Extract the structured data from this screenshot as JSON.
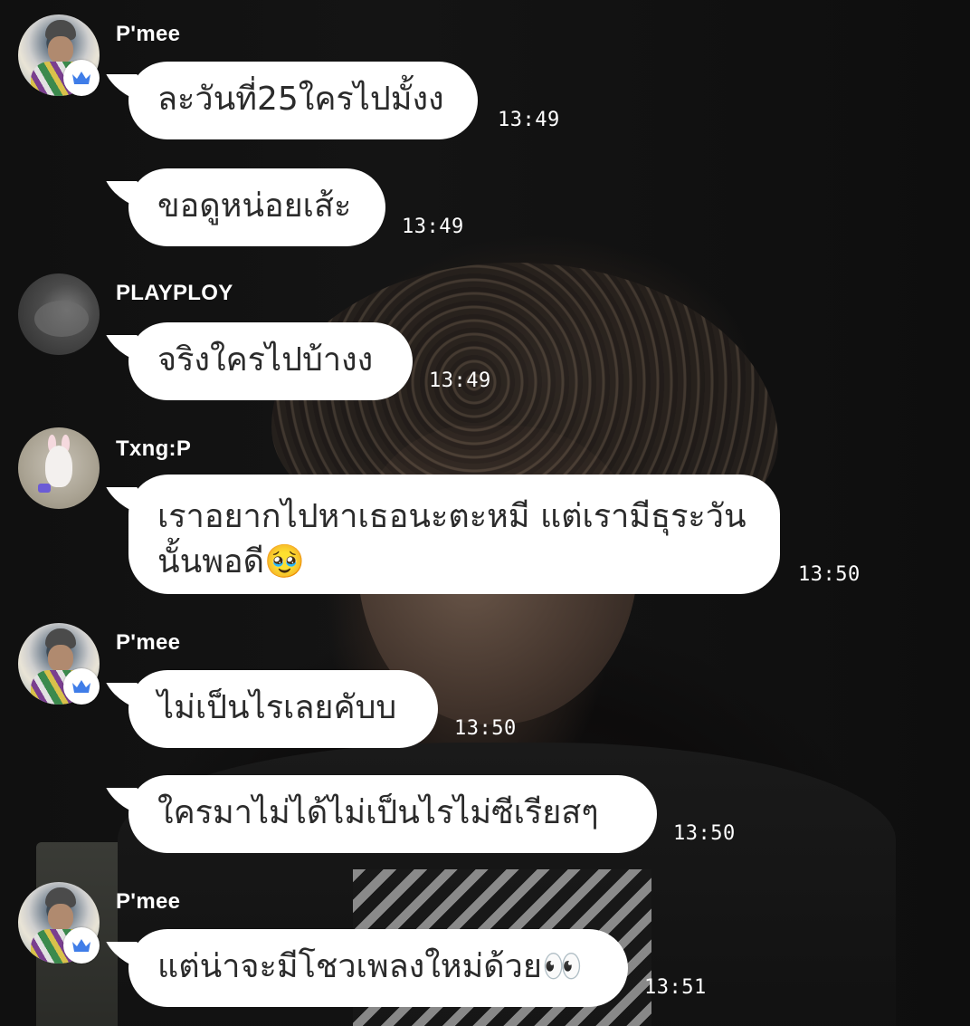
{
  "messages": [
    {
      "sender": "P'mee",
      "text": "ละวันที่25ใครไปมั้งง",
      "time": "13:49",
      "avatar_icon": "profile-photo",
      "badge_icon": "crown-icon"
    },
    {
      "sender": "",
      "text": "ขอดูหน่อยเส้ะ",
      "time": "13:49"
    },
    {
      "sender": "PLAYPLOY",
      "text": "จริงใครไปบ้างง",
      "time": "13:49",
      "avatar_icon": "profile-photo"
    },
    {
      "sender": "Txng:P",
      "text_line1": "เราอยากไปหาเธอนะตะหมี แต่เรามีธุระวัน",
      "text_line2": "นั้นพอดี🥹",
      "time": "13:50",
      "avatar_icon": "profile-photo"
    },
    {
      "sender": "P'mee",
      "text": "ไม่เป็นไรเลยคับบ",
      "time": "13:50",
      "avatar_icon": "profile-photo",
      "badge_icon": "crown-icon"
    },
    {
      "sender": "",
      "text": "ใครมาไม่ได้ไม่เป็นไรไม่ซีเรียสๆ",
      "time": "13:50"
    },
    {
      "sender": "P'mee",
      "text": "แต่น่าจะมีโชวเพลงใหม่ด้วย👀",
      "time": "13:51",
      "avatar_icon": "profile-photo",
      "badge_icon": "crown-icon"
    }
  ],
  "colors": {
    "bubble": "#ffffff",
    "text": "#2b2b2b",
    "crown": "#3f7de8",
    "name": "#ffffff",
    "time": "#ffffff"
  }
}
